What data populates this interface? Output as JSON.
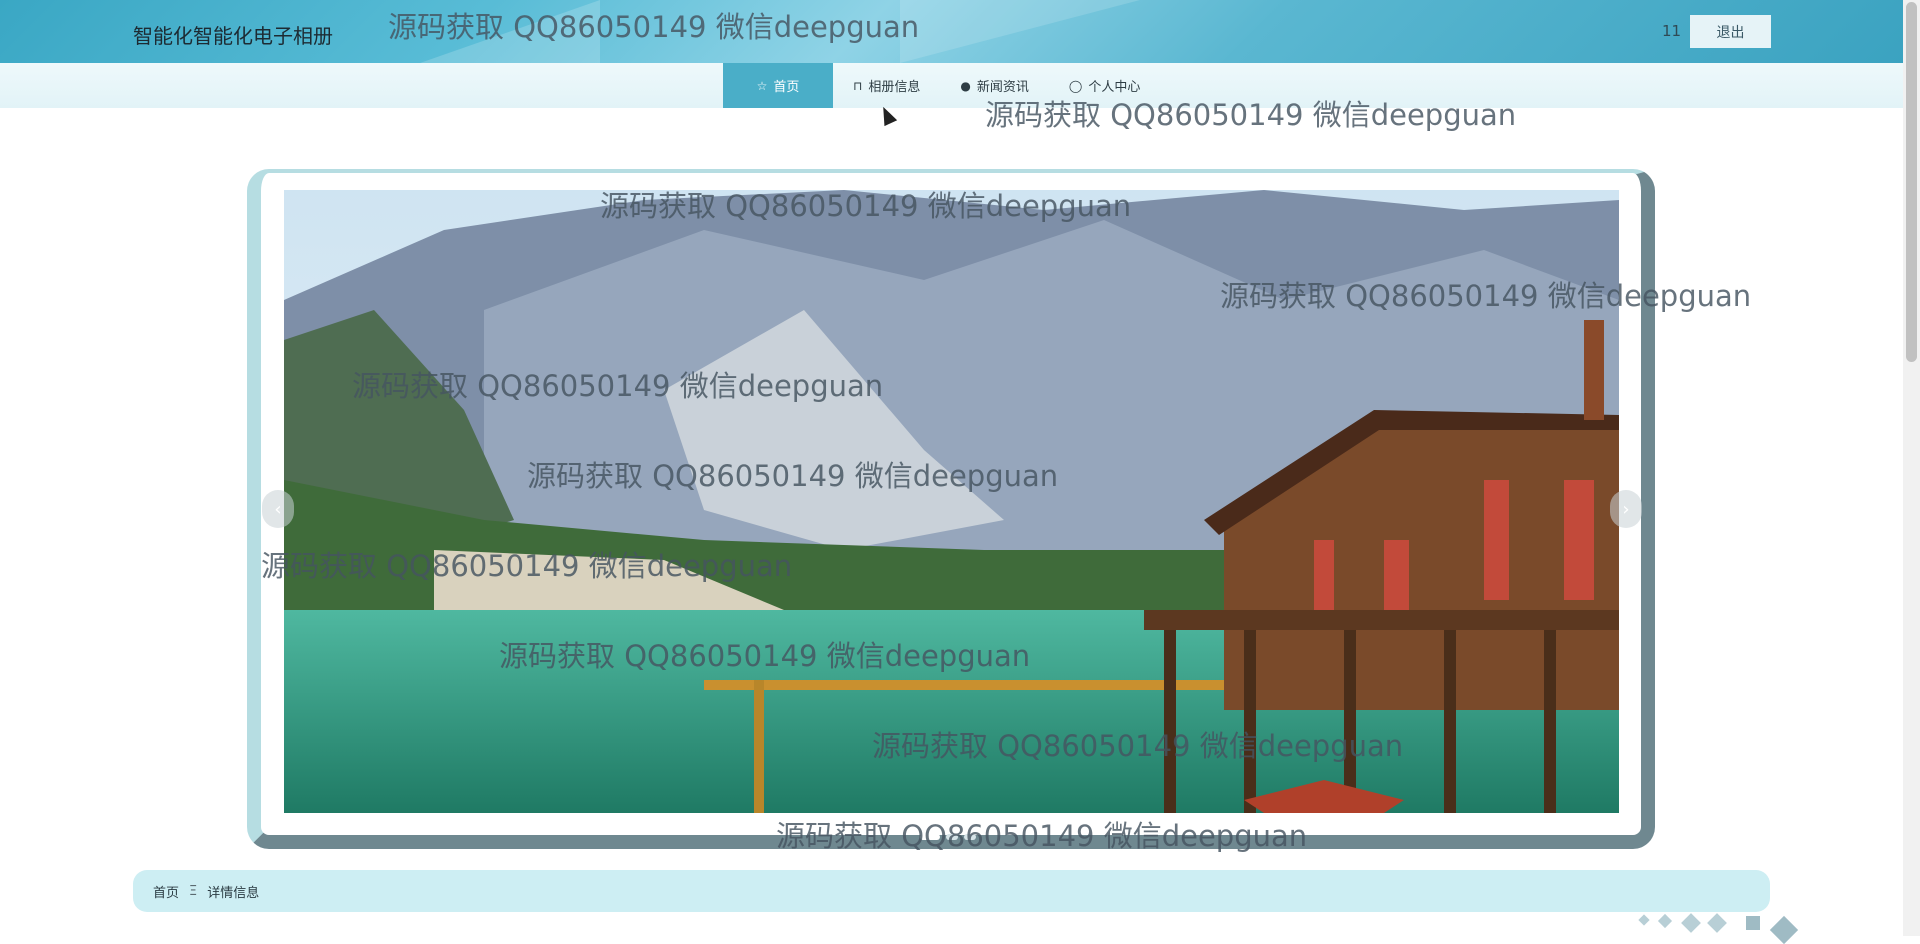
{
  "header": {
    "title": "智能化智能化电子相册",
    "user": "11",
    "logout_label": "退出"
  },
  "nav": {
    "items": [
      {
        "label": "首页",
        "icon": "star-icon",
        "active": true
      },
      {
        "label": "相册信息",
        "icon": "bag-icon"
      },
      {
        "label": "新闻资讯",
        "icon": "info-circle-icon"
      },
      {
        "label": "个人中心",
        "icon": "user-icon"
      }
    ]
  },
  "carousel": {
    "prev": "‹",
    "next": "›",
    "slide_count": 3,
    "active_slide": 1
  },
  "breadcrumb": {
    "home": "首页",
    "separator": "Ξ",
    "current": "详情信息"
  },
  "watermark": {
    "text": "源码获取 QQ86050149 微信deepguan"
  }
}
